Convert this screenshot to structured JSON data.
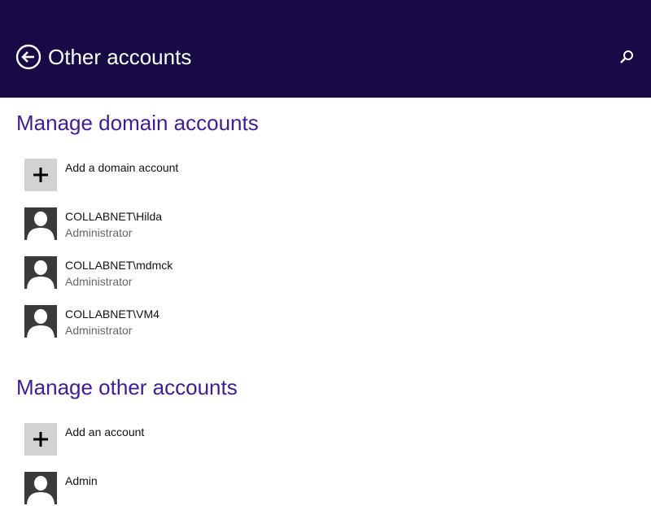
{
  "header": {
    "title": "Other accounts",
    "background": "#180b45",
    "back_icon": "back-arrow-circle-icon",
    "search_icon": "search-icon"
  },
  "domain_section": {
    "title": "Manage domain accounts",
    "add_label": "Add a domain account",
    "accounts": [
      {
        "name": "COLLABNET\\Hilda",
        "role": "Administrator"
      },
      {
        "name": "COLLABNET\\mdmck",
        "role": "Administrator"
      },
      {
        "name": "COLLABNET\\VM4",
        "role": "Administrator"
      }
    ]
  },
  "other_section": {
    "title": "Manage other accounts",
    "add_label": "Add an account",
    "accounts": [
      {
        "name": "Admin"
      }
    ]
  },
  "colors": {
    "accent_heading": "#3f1d95",
    "add_tile": "#d2d2d2",
    "user_tile": "#3a3a3a"
  }
}
